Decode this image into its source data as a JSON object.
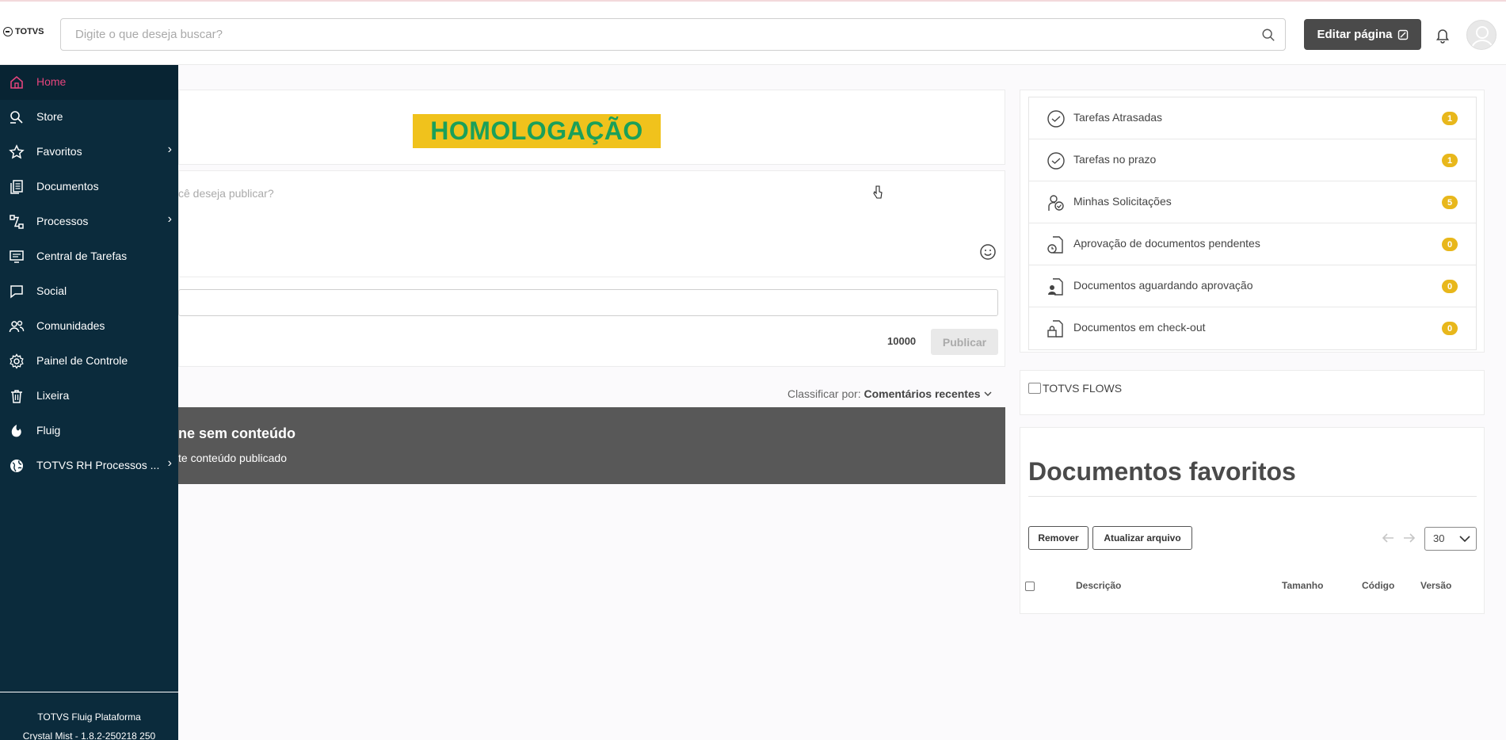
{
  "header": {
    "logo_text": "TOTVS",
    "search_placeholder": "Digite o que deseja buscar?",
    "edit_label": "Editar página"
  },
  "sidebar": {
    "items": [
      {
        "label": "Home",
        "icon": "home-icon",
        "active": true
      },
      {
        "label": "Store",
        "icon": "store-icon"
      },
      {
        "label": "Favoritos",
        "icon": "star-icon",
        "submenu": true
      },
      {
        "label": "Documentos",
        "icon": "documents-icon"
      },
      {
        "label": "Processos",
        "icon": "processes-icon",
        "submenu": true
      },
      {
        "label": "Central de Tarefas",
        "icon": "task-center-icon"
      },
      {
        "label": "Social",
        "icon": "chat-icon"
      },
      {
        "label": "Comunidades",
        "icon": "communities-icon"
      },
      {
        "label": "Painel de Controle",
        "icon": "gear-icon"
      },
      {
        "label": "Lixeira",
        "icon": "trash-icon"
      },
      {
        "label": "Fluig",
        "icon": "fluig-icon"
      },
      {
        "label": "TOTVS RH Processos ...",
        "icon": "globe-icon",
        "submenu": true
      }
    ],
    "footer_line1": "TOTVS Fluig Plataforma",
    "footer_line2": "Crystal Mist - 1.8.2-250218 250"
  },
  "main": {
    "banner": "HOMOLOGAÇÃO",
    "post_placeholder": "cê deseja publicar?",
    "counter": "10000",
    "publish_label": "Publicar",
    "sort_label": "Classificar por:",
    "sort_value": "Comentários recentes",
    "empty_title": "ne sem conteúdo",
    "empty_sub": "te conteúdo publicado"
  },
  "tasks": [
    {
      "label": "Tarefas Atrasadas",
      "count": "1",
      "icon": "check-circle-icon"
    },
    {
      "label": "Tarefas no prazo",
      "count": "1",
      "icon": "check-circle-icon"
    },
    {
      "label": "Minhas Solicitações",
      "count": "5",
      "icon": "user-check-icon"
    },
    {
      "label": "Aprovação de documentos pendentes",
      "count": "0",
      "icon": "document-clock-icon"
    },
    {
      "label": "Documentos aguardando aprovação",
      "count": "0",
      "icon": "document-user-icon"
    },
    {
      "label": "Documentos em check-out",
      "count": "0",
      "icon": "document-lock-icon"
    }
  ],
  "flows_alt": "TOTVS FLOWS",
  "favorites": {
    "title": "Documentos favoritos",
    "remove_label": "Remover",
    "update_label": "Atualizar arquivo",
    "page_size": "30",
    "columns": [
      "Descrição",
      "Tamanho",
      "Código",
      "Versão"
    ]
  },
  "colors": {
    "sidebar_bg": "#0b2b3c",
    "active": "#e5447d",
    "banner_bg": "#f0c21c",
    "banner_text": "#1aa05a",
    "badge": "#e8b71b"
  }
}
